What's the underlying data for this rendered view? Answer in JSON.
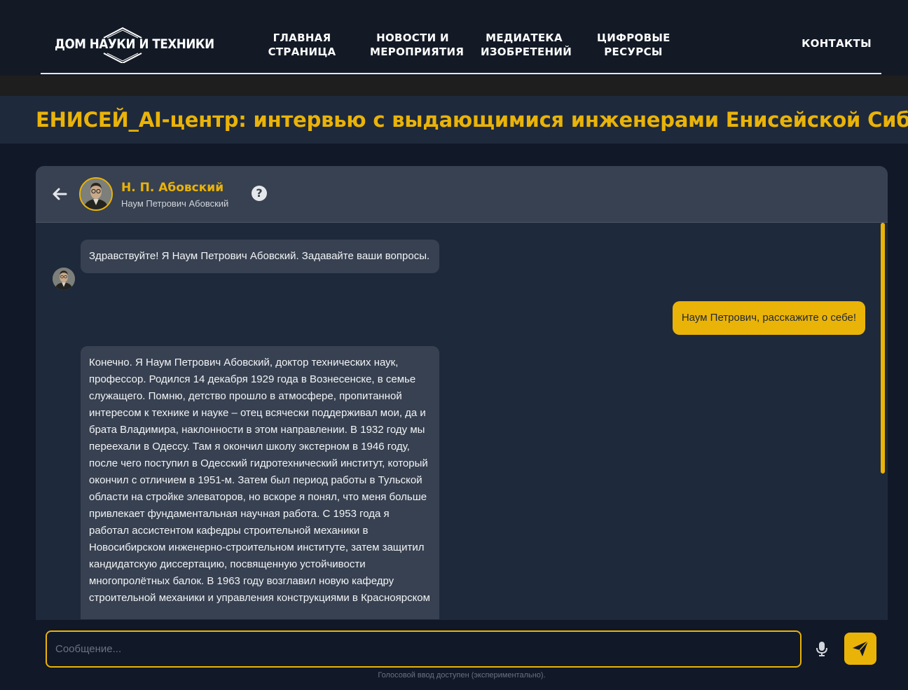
{
  "header": {
    "logo_text": "ДОМ НАУКИ И ТЕХНИКИ",
    "nav": [
      {
        "label": "ГЛАВНАЯ\nСТРАНИЦА"
      },
      {
        "label": "НОВОСТИ  И\nМЕРОПРИЯТИЯ"
      },
      {
        "label": "МЕДИАТЕКА\nИЗОБРЕТЕНИЙ"
      },
      {
        "label": "ЦИФРОВЫЕ\nРЕСУРСЫ"
      },
      {
        "label": "КОНТАКТЫ"
      }
    ]
  },
  "page": {
    "title": "ЕНИСЕЙ_AI-центр: интервью с выдающимися инженерами Енисейской Сибири"
  },
  "chat": {
    "persona_name": "Н. П. Абовский",
    "persona_full_name": "Наум Петрович Абовский",
    "help_label": "?",
    "messages": [
      {
        "role": "bot",
        "text": "Здравствуйте! Я Наум Петрович Абовский. Задавайте ваши вопросы."
      },
      {
        "role": "user",
        "text": "Наум Петрович, расскажите о себе!"
      },
      {
        "role": "bot",
        "text": "Конечно. Я Наум Петрович Абовский, доктор технических наук, профессор. Родился 14 декабря 1929 года в Вознесенске, в семье служащего. Помню, детство прошло в атмосфере, пропитанной интересом к технике и науке – отец всячески поддерживал мои, да и брата Владимира, наклонности в этом направлении. В 1932 году мы переехали в Одессу. Там я окончил школу экстерном в 1946 году, после чего поступил в Одесский гидротехнический институт, который окончил с отличием в 1951-м. Затем был период работы в Тульской области на стройке элеваторов, но вскоре я понял, что меня больше привлекает фундаментальная научная работа. С 1953 года я работал ассистентом кафедры строительной механики в Новосибирском инженерно-строительном институте, затем защитил кандидатскую диссертацию, посвященную устойчивости многопролётных балок. В 1963 году возглавил новую кафедру строительной механики и управления конструкциями в Красноярском"
      }
    ],
    "input": {
      "placeholder": "Сообщение...",
      "value": ""
    },
    "voice_note": "Голосовой ввод доступен (экспериментально)."
  },
  "colors": {
    "accent": "#eab308",
    "background": "#111827",
    "panel": "#1e293b",
    "bubble_bot": "#374151"
  },
  "icons": [
    "back-arrow-icon",
    "help-icon",
    "microphone-icon",
    "send-icon"
  ]
}
